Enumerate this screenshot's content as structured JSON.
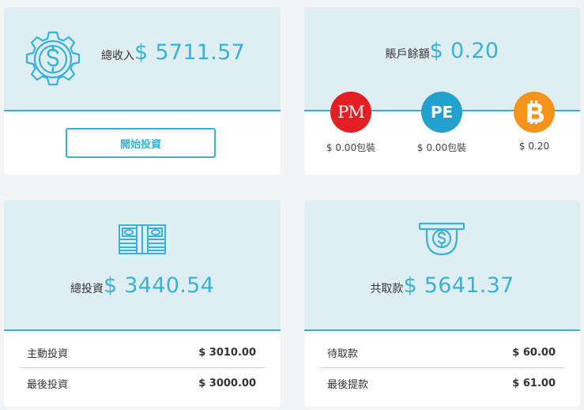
{
  "income": {
    "label": "總收入",
    "value": "$ 5711.57",
    "button_label": "開始投資"
  },
  "balance": {
    "label": "賬戶餘額",
    "value": "$ 0.20",
    "coins": [
      {
        "icon": "perfect-money-icon",
        "symbol": "PM",
        "color": "#e31e25",
        "amount": "$ 0.00包裝"
      },
      {
        "icon": "payeer-icon",
        "symbol": "PE",
        "color": "#24a0cc",
        "amount": "$ 0.00包裝"
      },
      {
        "icon": "bitcoin-icon",
        "symbol": "₿",
        "color": "#f7931a",
        "amount": "$ 0.20"
      }
    ]
  },
  "investment": {
    "label": "總投資",
    "value": "$ 3440.54",
    "rows": [
      {
        "label": "主動投資",
        "value": "$ 3010.00"
      },
      {
        "label": "最後投資",
        "value": "$ 3000.00"
      }
    ]
  },
  "withdrawal": {
    "label": "共取款",
    "value": "$ 5641.37",
    "rows": [
      {
        "label": "待取款",
        "value": "$ 60.00"
      },
      {
        "label": "最後提款",
        "value": "$ 61.00"
      }
    ]
  },
  "colors": {
    "accent": "#38b2d6",
    "panel_top": "#dfeef3",
    "page_bg": "#f2f4f5"
  }
}
